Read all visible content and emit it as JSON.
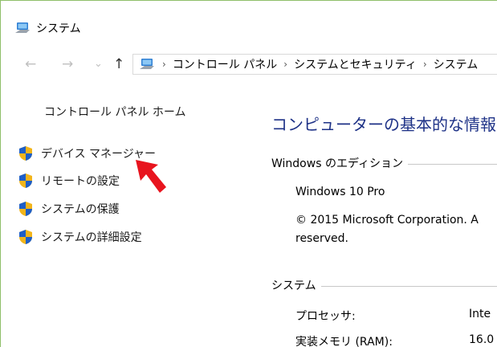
{
  "window": {
    "title": "システム"
  },
  "nav": {
    "back_icon": "←",
    "forward_icon": "→",
    "recent_icon": "⌄",
    "up_icon": "↑",
    "breadcrumb": [
      "コントロール パネル",
      "システムとセキュリティ",
      "システム"
    ]
  },
  "sidebar": {
    "home_link": "コントロール パネル ホーム",
    "items": [
      {
        "label": "デバイス マネージャー"
      },
      {
        "label": "リモートの設定"
      },
      {
        "label": "システムの保護"
      },
      {
        "label": "システムの詳細設定"
      }
    ]
  },
  "main": {
    "title": "コンピューターの基本的な情報の",
    "edition_header": "Windows のエディション",
    "edition_name": "Windows 10 Pro",
    "copyright_line1": "© 2015 Microsoft Corporation. A",
    "copyright_line2": "reserved.",
    "system_header": "システム",
    "processor_label": "プロセッサ:",
    "processor_value": "Inte",
    "ram_label": "実装メモリ (RAM):",
    "ram_value": "16.0"
  },
  "colors": {
    "title_blue": "#1e3287",
    "pointer_red": "#e8141e",
    "window_border": "#8fbf6a"
  }
}
